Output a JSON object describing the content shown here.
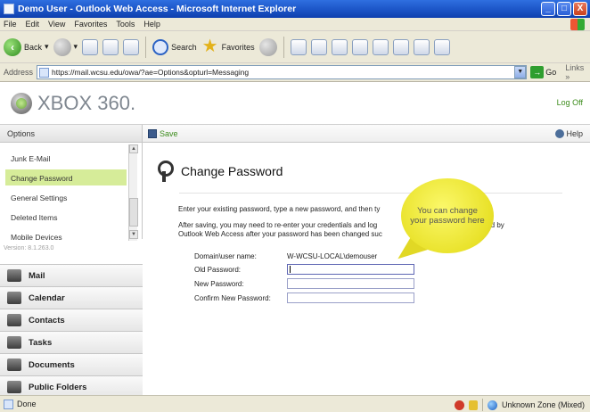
{
  "window": {
    "title": "Demo User - Outlook Web Access - Microsoft Internet Explorer",
    "controls": [
      "_",
      "□",
      "X"
    ]
  },
  "menu": [
    "File",
    "Edit",
    "View",
    "Favorites",
    "Tools",
    "Help"
  ],
  "toolbar": {
    "back": "Back",
    "search": "Search",
    "favorites": "Favorites"
  },
  "address": {
    "label": "Address",
    "url": "https://mail.wcsu.edu/owa/?ae=Options&opturl=Messaging",
    "go": "Go",
    "links": "Links"
  },
  "owa": {
    "brand": "XBOX 360.",
    "logoff": "Log Off",
    "options_label": "Options",
    "save_label": "Save",
    "help_label": "Help"
  },
  "nav": {
    "items": [
      {
        "label": "Junk E-Mail"
      },
      {
        "label": "Change Password"
      },
      {
        "label": "General Settings"
      },
      {
        "label": "Deleted Items"
      },
      {
        "label": "Mobile Devices"
      }
    ],
    "selected_index": 1,
    "version": "Version: 8.1.263.0"
  },
  "modules": [
    {
      "label": "Mail",
      "icon": "mail-icon"
    },
    {
      "label": "Calendar",
      "icon": "calendar-icon"
    },
    {
      "label": "Contacts",
      "icon": "contacts-icon"
    },
    {
      "label": "Tasks",
      "icon": "tasks-icon"
    },
    {
      "label": "Documents",
      "icon": "documents-icon"
    },
    {
      "label": "Public Folders",
      "icon": "public-folders-icon"
    }
  ],
  "content": {
    "title": "Change Password",
    "para1": "Enter your existing password, type a new password, and then ty",
    "para2_line1": "After saving, you may need to re-enter your credentials and log",
    "para2_line1_end": "ted by",
    "para2_line2": "Outlook Web Access after your password has been changed suc",
    "form": {
      "domain_label": "Domain\\user name:",
      "domain_value": "W-WCSU-LOCAL\\demouser",
      "old_label": "Old Password:",
      "new_label": "New Password:",
      "confirm_label": "Confirm New Password:"
    },
    "callout": "You can change your password here"
  },
  "status": {
    "text": "Done",
    "zone": "Unknown Zone (Mixed)"
  },
  "colors": {
    "accent_green": "#3c8c1c",
    "selected_nav": "#d6ec99",
    "callout_yellow": "#ede72c"
  }
}
